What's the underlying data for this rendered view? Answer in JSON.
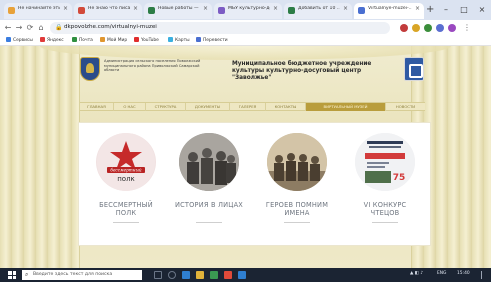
{
  "browser": {
    "tabs": [
      {
        "label": "Не начинайте эти обр...",
        "color": "#e8a23a",
        "active": false
      },
      {
        "label": "Не знаю что писать сл...",
        "color": "#d24a3a",
        "active": false
      },
      {
        "label": "Новые работы — ...",
        "color": "#2d7d46",
        "active": false
      },
      {
        "label": "МБУ культурно-дос...",
        "color": "#7c5cc4",
        "active": false
      },
      {
        "label": "Добавить от 10 ...",
        "color": "#2d7d46",
        "active": false
      },
      {
        "label": "Virtualnye-muzei-...",
        "color": "#4a6fd1",
        "active": true
      }
    ],
    "new_tab": "+",
    "window_controls": [
      "–",
      "□",
      "×"
    ],
    "url": "dkpovolzhe.com/virtualnyi-muzei",
    "nav": {
      "back": "←",
      "forward": "→",
      "reload": "⟳",
      "home": "⌂"
    },
    "toolbar_icon_colors": [
      "#c23b3b",
      "#d9a526",
      "#3b8e3b",
      "#5b6fd1",
      "#9a49c0"
    ],
    "bookmarks": [
      {
        "label": "Сервисы",
        "color": "#3b7de0"
      },
      {
        "label": "Яндекс",
        "color": "#e03b3b"
      },
      {
        "label": "Почта",
        "color": "#2f8f3f"
      },
      {
        "label": "Мой Мир",
        "color": "#e0962f"
      },
      {
        "label": "YouTube",
        "color": "#e02d2d"
      },
      {
        "label": "Карты",
        "color": "#3bb0e0"
      },
      {
        "label": "Перевести",
        "color": "#4a6fd1"
      }
    ]
  },
  "site": {
    "admin_text": "Администрация сельского поселения Поволжский муниципального района Приволжский Самарской области",
    "institution_name": "Муниципальное бюджетное учреждение культуры культурно-досуговый центр \"Заволжье\"",
    "menu": [
      {
        "label": "ГЛАВНАЯ",
        "active": false
      },
      {
        "label": "О НАС",
        "active": false
      },
      {
        "label": "СТРУКТУРА",
        "active": false
      },
      {
        "label": "ДОКУМЕНТЫ",
        "active": false
      },
      {
        "label": "ГАЛЕРЕЯ",
        "active": false
      },
      {
        "label": "КОНТАКТЫ",
        "active": false
      },
      {
        "label": "ВИРТУАЛЬНЫЙ МУЗЕЙ",
        "active": true
      },
      {
        "label": "НОВОСТИ",
        "active": false
      }
    ],
    "cards": [
      {
        "label": "БЕССМЕРТНЫЙ ПОЛК",
        "logo_text": "полк",
        "logo_script": "бессмертный"
      },
      {
        "label": "ИСТОРИЯ В ЛИЦАХ"
      },
      {
        "label": "ГЕРОЕВ ПОМНИМ ИМЕНА"
      },
      {
        "label": "VI КОНКУРС ЧТЕЦОВ",
        "poster_number": "75"
      }
    ],
    "accent_color": "#b99d3c"
  },
  "taskbar": {
    "search_placeholder": "Введите здесь текст для поиска",
    "tray_text": "ENG",
    "clock": "15:40",
    "app_colors": [
      "#6b7688",
      "#6b7688",
      "#2f7fd1",
      "#e0b23a",
      "#3a9a52",
      "#e04a3a",
      "#2f7fd1"
    ]
  }
}
